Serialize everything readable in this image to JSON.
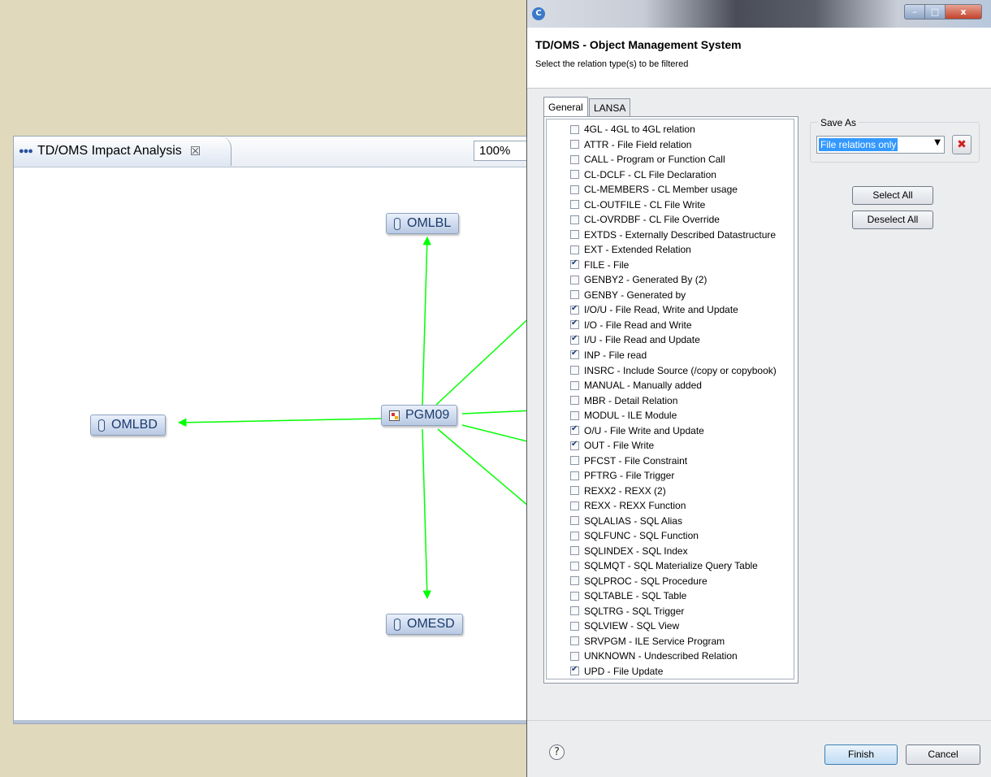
{
  "editor": {
    "tab_title": "TD/OMS Impact Analysis",
    "zoom": "100%",
    "nodes": {
      "top": "OMLBL",
      "left": "OMLBD",
      "center": "PGM09",
      "bottom": "OMESD"
    },
    "edge_color": "#00ff00"
  },
  "dialog": {
    "title": "TD/OMS - Object Management System",
    "subtitle": "Select the relation type(s) to be filtered",
    "window_buttons": {
      "minimize": "–",
      "maximize": "□",
      "close": "x"
    },
    "tabs": [
      {
        "label": "General",
        "active": true
      },
      {
        "label": "LANSA",
        "active": false
      }
    ],
    "relations": [
      {
        "label": "4GL - 4GL to 4GL relation",
        "checked": false
      },
      {
        "label": "ATTR - File Field relation",
        "checked": false
      },
      {
        "label": "CALL - Program or Function Call",
        "checked": false
      },
      {
        "label": "CL-DCLF - CL File Declaration",
        "checked": false
      },
      {
        "label": "CL-MEMBERS - CL Member usage",
        "checked": false
      },
      {
        "label": "CL-OUTFILE - CL File Write",
        "checked": false
      },
      {
        "label": "CL-OVRDBF - CL File Override",
        "checked": false
      },
      {
        "label": "EXTDS - Externally Described Datastructure",
        "checked": false
      },
      {
        "label": "EXT - Extended Relation",
        "checked": false
      },
      {
        "label": "FILE - File",
        "checked": true
      },
      {
        "label": "GENBY2 - Generated By (2)",
        "checked": false
      },
      {
        "label": "GENBY - Generated by",
        "checked": false
      },
      {
        "label": "I/O/U - File Read, Write and Update",
        "checked": true
      },
      {
        "label": "I/O - File Read and Write",
        "checked": true
      },
      {
        "label": "I/U - File Read and Update",
        "checked": true
      },
      {
        "label": "INP - File read",
        "checked": true
      },
      {
        "label": "INSRC - Include Source (/copy or copybook)",
        "checked": false
      },
      {
        "label": "MANUAL - Manually added",
        "checked": false
      },
      {
        "label": "MBR - Detail Relation",
        "checked": false
      },
      {
        "label": "MODUL - ILE Module",
        "checked": false
      },
      {
        "label": "O/U - File Write and Update",
        "checked": true
      },
      {
        "label": "OUT - File Write",
        "checked": true
      },
      {
        "label": "PFCST - File Constraint",
        "checked": false
      },
      {
        "label": "PFTRG - File Trigger",
        "checked": false
      },
      {
        "label": "REXX2 - REXX (2)",
        "checked": false
      },
      {
        "label": "REXX - REXX Function",
        "checked": false
      },
      {
        "label": "SQLALIAS - SQL Alias",
        "checked": false
      },
      {
        "label": "SQLFUNC - SQL Function",
        "checked": false
      },
      {
        "label": "SQLINDEX - SQL Index",
        "checked": false
      },
      {
        "label": "SQLMQT - SQL Materialize Query Table",
        "checked": false
      },
      {
        "label": "SQLPROC - SQL Procedure",
        "checked": false
      },
      {
        "label": "SQLTABLE - SQL Table",
        "checked": false
      },
      {
        "label": "SQLTRG - SQL Trigger",
        "checked": false
      },
      {
        "label": "SQLVIEW - SQL View",
        "checked": false
      },
      {
        "label": "SRVPGM - ILE Service Program",
        "checked": false
      },
      {
        "label": "UNKNOWN - Undescribed Relation",
        "checked": false
      },
      {
        "label": "UPD - File Update",
        "checked": true
      }
    ],
    "save_as": {
      "label": "Save As",
      "value": "File relations only"
    },
    "buttons": {
      "select_all": "Select All",
      "deselect_all": "Deselect All",
      "finish": "Finish",
      "cancel": "Cancel",
      "help": "?"
    }
  }
}
